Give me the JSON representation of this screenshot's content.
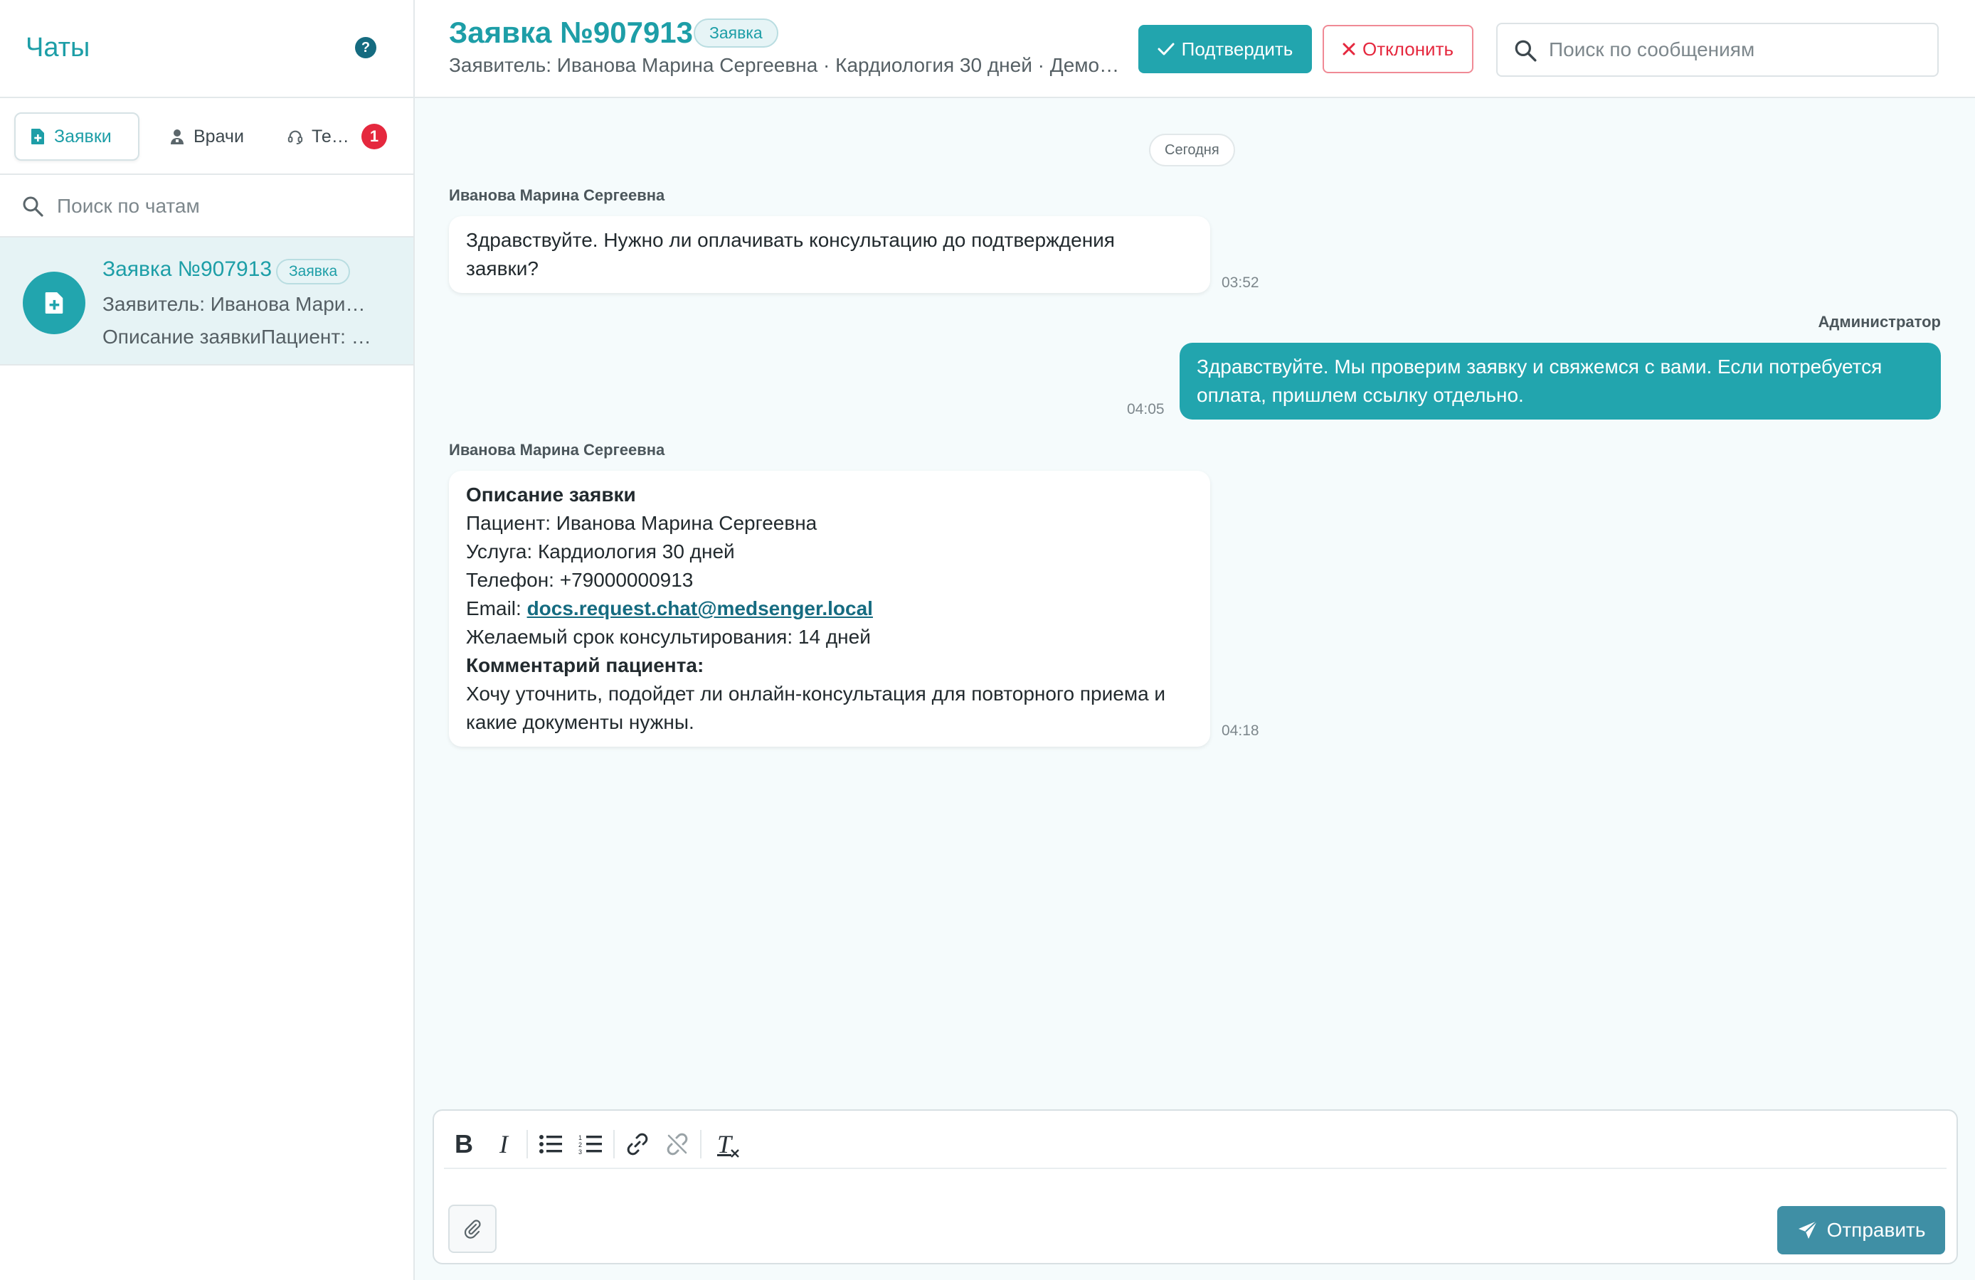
{
  "sidebar": {
    "title": "Чаты",
    "help": "?",
    "tabs": [
      {
        "label": "Заявки",
        "icon": "document-plus-icon",
        "active": true
      },
      {
        "label": "Врачи",
        "icon": "doctor-icon",
        "active": false
      },
      {
        "label": "Те…",
        "icon": "headset-icon",
        "active": false,
        "badge": "1"
      }
    ],
    "search": {
      "placeholder": "Поиск по чатам",
      "value": ""
    },
    "chats": [
      {
        "title": "Заявка №907913",
        "chip": "Заявка",
        "line1": "Заявитель: Иванова Марина Сергеевна",
        "line2": "Описание заявкиПациент: Иванова Марина Сергеевна",
        "selected": true
      }
    ]
  },
  "header": {
    "title": "Заявка №907913",
    "chip": "Заявка",
    "subtitle": "Заявитель: Иванова Марина Сергеевна · Кардиология 30 дней · Демо…",
    "confirm_label": "Подтвердить",
    "reject_label": "Отклонить",
    "search_placeholder": "Поиск по сообщениям"
  },
  "messages": {
    "day_separator": "Сегодня",
    "items": [
      {
        "sender": "Иванова Марина Сергеевна",
        "direction": "in",
        "text_lines": [
          "Здравствуйте. Нужно ли оплачивать консультацию до подтверждения",
          "заявки?"
        ],
        "time": "03:52"
      },
      {
        "sender": "Администратор",
        "direction": "out",
        "text_lines": [
          "Здравствуйте. Мы проверим заявку и свяжемся с вами. Если потребуется",
          "оплата, пришлем ссылку отдельно."
        ],
        "time": "04:05"
      },
      {
        "sender": "Иванова Марина Сергеевна",
        "direction": "in",
        "time": "04:18",
        "heading": "Описание заявки",
        "patient": "Пациент: Иванова Марина Сергеевна",
        "service": "Услуга: Кардиология 30 дней",
        "phone": "Телефон: +79000000913",
        "email_label": "Email: ",
        "email": "docs.request.chat@medsenger.local",
        "term": "Желаемый срок консультирования: 14 дней",
        "comment_heading": "Комментарий пациента:",
        "comment_lines": [
          "Хочу уточнить, подойдет ли онлайн-консультация для повторного приема и",
          "какие документы нужны."
        ]
      }
    ]
  },
  "composer": {
    "toolbar": [
      "bold-icon",
      "italic-icon",
      "bullet-list-icon",
      "numbered-list-icon",
      "link-icon",
      "unlink-icon",
      "clear-format-icon"
    ],
    "bold": "B",
    "italic": "I",
    "clear": "T",
    "send_label": "Отправить"
  },
  "colors": {
    "accent": "#22a5ae",
    "accent_text": "#1d9ea7",
    "danger": "#e5283e",
    "send": "#3f8fa5"
  }
}
